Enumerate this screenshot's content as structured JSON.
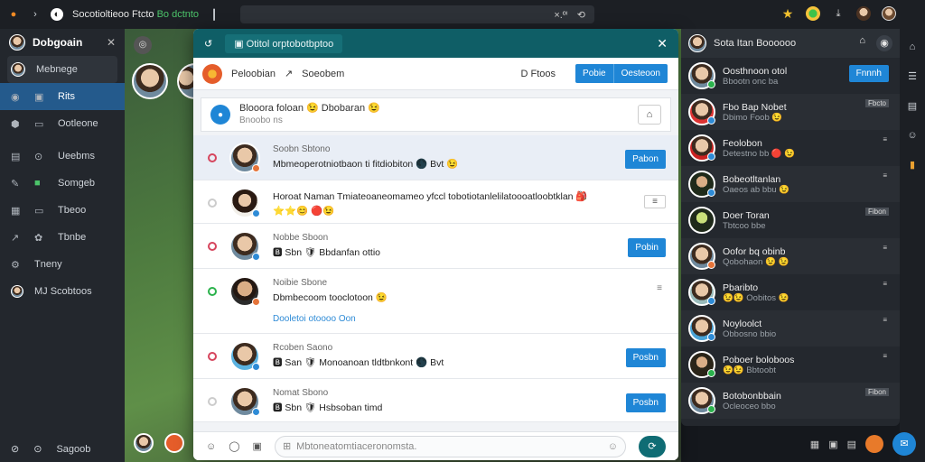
{
  "browser": {
    "title_prefix": "Socoti",
    "title_mid": "oltieoo Ftcto",
    "title_green": "Bo dctnto",
    "address_icons": [
      "×.ºⁱ",
      "⟲"
    ]
  },
  "sidebar": {
    "header": "Dobgoain",
    "items": [
      {
        "label": "Mebnege",
        "icon": "avatar"
      },
      {
        "label": "Rits",
        "icon": "grid"
      },
      {
        "label": "Ootleone",
        "icon": "shield"
      },
      {
        "label": "Ueebms",
        "icon": "box"
      },
      {
        "label": "Somgeb",
        "icon": "wrench"
      },
      {
        "label": "Tbeoo",
        "icon": "image"
      },
      {
        "label": "Tbnbe",
        "icon": "chart"
      },
      {
        "label": "Tneny",
        "icon": "gear"
      },
      {
        "label": "MJ Scobtoos",
        "icon": "avatar"
      }
    ],
    "footer": "Sagoob"
  },
  "modal": {
    "title": "Otitol orptobotbptoo",
    "sub_title": "Peloobian",
    "sub_link": "Soeobem",
    "sub_label": "D Ftoos",
    "btn_a": "Pobie",
    "btn_b": "Oesteoon",
    "composer_title": "Blooora foloan 😉 Dbobaran 😉",
    "composer_sub": "Bnoobo ns",
    "rows": [
      {
        "name": "Soobn Sbtono",
        "msg": "Mbmeoperotniotbaon ti fitdiobiton 🌑 Bvt 😉",
        "btn": "Pabon",
        "mark": "#d6455d"
      },
      {
        "name": "",
        "msg": "Horoat Naman Tmiateoaneomameo yfccl tobotiotanlelilatoooatloobtklan 🎒",
        "msg2": "⭐⭐😊 🔴😉",
        "btn": "≡",
        "mark": "#bbb"
      },
      {
        "name": "Nobbe Sboon",
        "msg": "🅱 Sbn 🛡 Bbdanfan ottio",
        "btn": "Pobin",
        "mark": "#d6455d"
      },
      {
        "name": "Noibie Sbone",
        "msg": "Dbmbecoom tooclotoon 😉",
        "msg2": "Dooletoi otoooo Oon",
        "btn": "≡",
        "mark": "#2bb24c"
      },
      {
        "name": "Rcoben Saono",
        "msg": "🅱 San 🛡 Monoanoan tldtbnkont 🌑 Bvt",
        "btn": "Posbn",
        "mark": "#d6455d"
      },
      {
        "name": "Nomat Sbono",
        "msg": "🅱 Sbn 🛡 Hsbsoban timd",
        "btn": "Posbn",
        "mark": "#bbb"
      }
    ],
    "input_placeholder": "Mbtoneatomtiaceronomsta."
  },
  "right": {
    "header": "Sota Itan Boooooo",
    "contacts": [
      {
        "name": "Oosthnoon otol",
        "sub": "Bbootn onc ba",
        "btn": "Fnnnh"
      },
      {
        "name": "Fbo Bap Nobet",
        "sub": "Dbimo Foob 😉",
        "tag": "Fbcto"
      },
      {
        "name": "Feolobon",
        "sub": "Detestno bb 🔴 😉",
        "tag": "≡"
      },
      {
        "name": "Bobeotltanlan",
        "sub": "Oaeos ab bbu 😉",
        "tag": "≡"
      },
      {
        "name": "Doer Toran",
        "sub": "Tbtcoo bbe",
        "tag": "Fibon"
      },
      {
        "name": "Oofor bq obinb",
        "sub": "Qobohaon 😉 😉",
        "tag": "≡"
      },
      {
        "name": "Pbaribto",
        "sub": "😉😉 Oobitos 😉",
        "tag": "≡"
      },
      {
        "name": "Noyloolct",
        "sub": "Obbosno bbio",
        "tag": "≡"
      },
      {
        "name": "Poboer boloboos",
        "sub": "😉😉 Bbtoobt",
        "tag": "≡"
      },
      {
        "name": "Botobonbbain",
        "sub": "Ocleoceo bbo",
        "tag": "Fibon"
      }
    ]
  }
}
